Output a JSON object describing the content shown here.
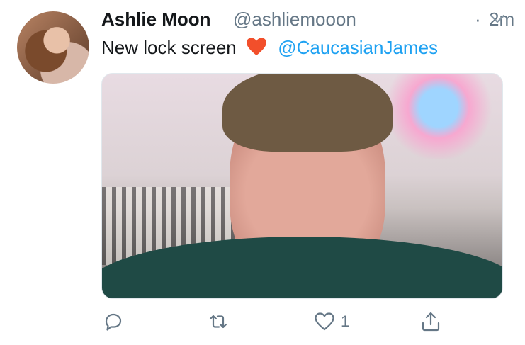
{
  "tweet": {
    "author_name": "Ashlie Moon",
    "author_handle": "@ashliemooon",
    "separator": "·",
    "time_ago": "2m",
    "text": "New lock screen",
    "emoji": "heart",
    "mention": "@CaucasianJames",
    "media": {
      "description_icon": "photo"
    },
    "actions": {
      "reply_icon": "reply-icon",
      "retweet_icon": "retweet-icon",
      "like_icon": "heart-icon",
      "like_count": "1",
      "share_icon": "share-icon"
    }
  },
  "colors": {
    "text": "#14171a",
    "secondary": "#657786",
    "link": "#1da1f2",
    "emoji_heart": "#f24f2b"
  }
}
